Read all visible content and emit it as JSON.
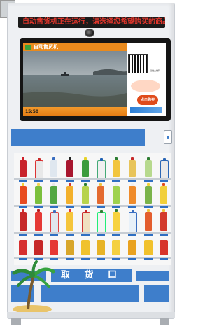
{
  "ticker": {
    "text": "自动售货机正在运行，请选择您希望购买的商品…"
  },
  "screen": {
    "title": "自动售货机",
    "time": "15:58",
    "scan_label": "扫描二维码",
    "promo_label": "点击购买"
  },
  "outlet": {
    "label": "取 货 口"
  },
  "colors": {
    "accent_blue": "#3e7ecb",
    "orange": "#e98a1d",
    "ticker_red": "#e0362c"
  }
}
